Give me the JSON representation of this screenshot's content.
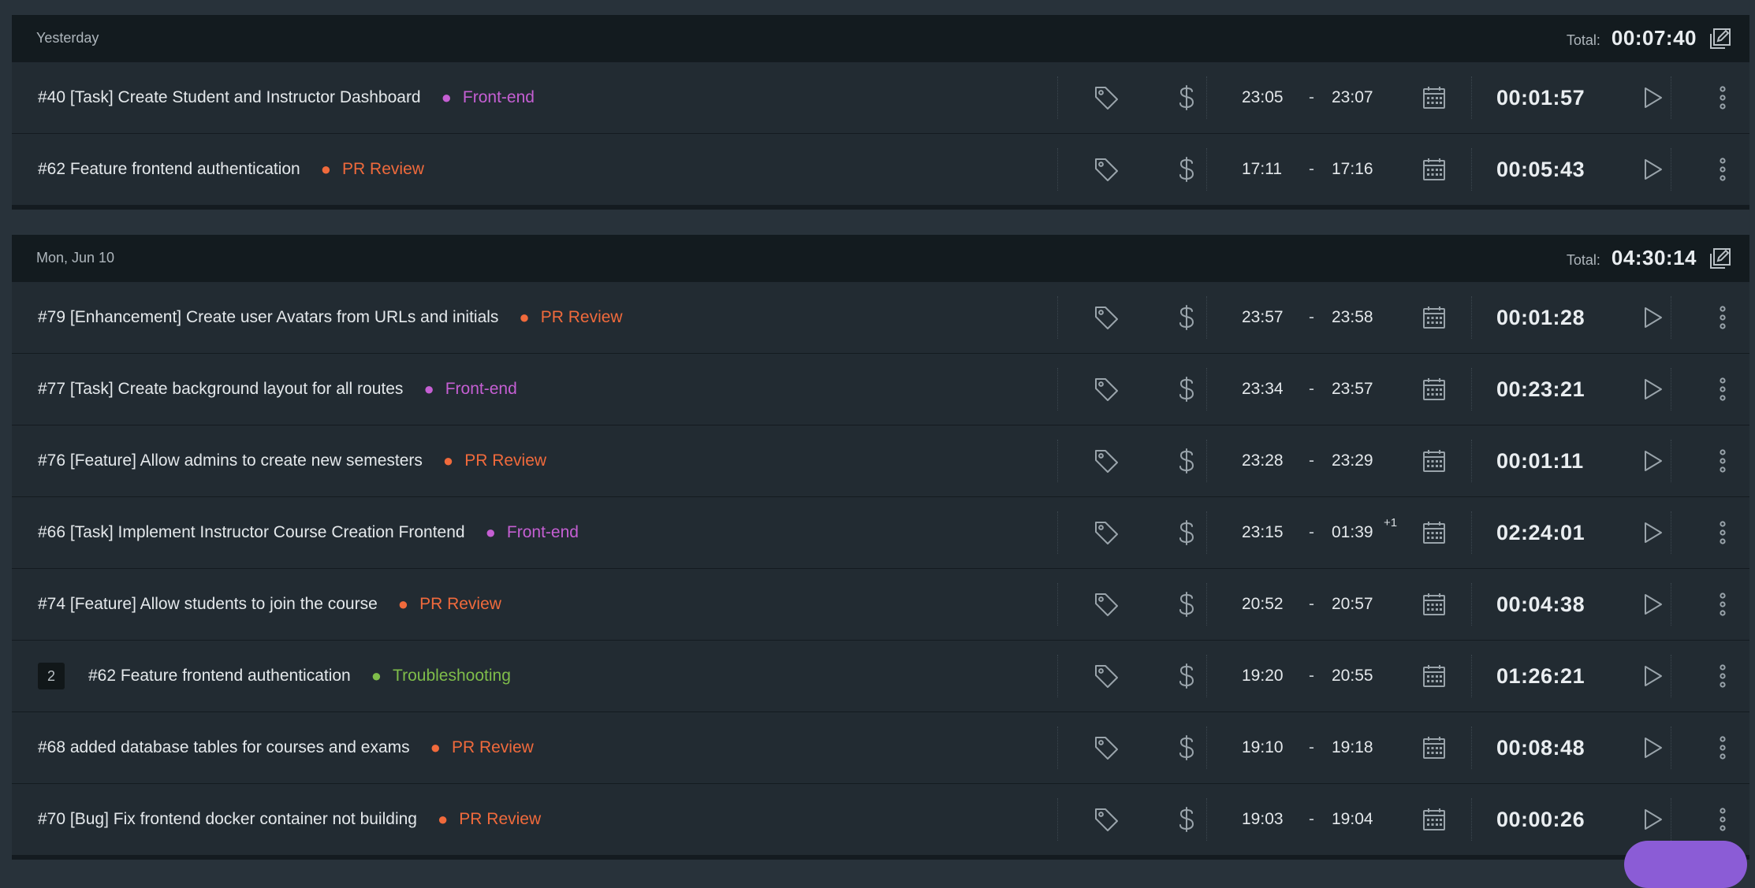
{
  "colors": {
    "front_end": "#c55fd3",
    "pr_review": "#f06a3c",
    "troubleshooting": "#7fbd4a",
    "fab": "#8b5cd6"
  },
  "groups": [
    {
      "date": "Yesterday",
      "total_label": "Total:",
      "total": "00:07:40",
      "entries": [
        {
          "description": "#40 [Task] Create Student and Instructor Dashboard",
          "project": "Front-end",
          "project_color": "#c55fd3",
          "start": "23:05",
          "end": "23:07",
          "duration": "00:01:57"
        },
        {
          "description": "#62 Feature frontend authentication",
          "project": "PR Review",
          "project_color": "#f06a3c",
          "start": "17:11",
          "end": "17:16",
          "duration": "00:05:43"
        }
      ]
    },
    {
      "date": "Mon, Jun 10",
      "total_label": "Total:",
      "total": "04:30:14",
      "entries": [
        {
          "description": "#79 [Enhancement] Create user Avatars from URLs and initials",
          "project": "PR Review",
          "project_color": "#f06a3c",
          "start": "23:57",
          "end": "23:58",
          "duration": "00:01:28"
        },
        {
          "description": "#77 [Task] Create background layout for all routes",
          "project": "Front-end",
          "project_color": "#c55fd3",
          "start": "23:34",
          "end": "23:57",
          "duration": "00:23:21"
        },
        {
          "description": "#76 [Feature] Allow admins to create new semesters",
          "project": "PR Review",
          "project_color": "#f06a3c",
          "start": "23:28",
          "end": "23:29",
          "duration": "00:01:11"
        },
        {
          "description": "#66 [Task] Implement Instructor Course Creation Frontend",
          "project": "Front-end",
          "project_color": "#c55fd3",
          "start": "23:15",
          "end": "01:39",
          "plus_days": "+1",
          "duration": "02:24:01"
        },
        {
          "description": "#74 [Feature] Allow students to join the course",
          "project": "PR Review",
          "project_color": "#f06a3c",
          "start": "20:52",
          "end": "20:57",
          "duration": "00:04:38"
        },
        {
          "group_count": "2",
          "description": "#62 Feature frontend authentication",
          "project": "Troubleshooting",
          "project_color": "#7fbd4a",
          "start": "19:20",
          "end": "20:55",
          "duration": "01:26:21"
        },
        {
          "description": "#68 added database tables for courses and exams",
          "project": "PR Review",
          "project_color": "#f06a3c",
          "start": "19:10",
          "end": "19:18",
          "duration": "00:08:48"
        },
        {
          "description": "#70 [Bug] Fix frontend docker container not building",
          "project": "PR Review",
          "project_color": "#f06a3c",
          "start": "19:03",
          "end": "19:04",
          "duration": "00:00:26"
        }
      ]
    }
  ],
  "dash": "-",
  "dot_char": "●",
  "icons": [
    "tag-icon",
    "dollar-icon",
    "calendar-icon",
    "play-icon",
    "more-vertical-icon",
    "bulk-edit-icon"
  ]
}
